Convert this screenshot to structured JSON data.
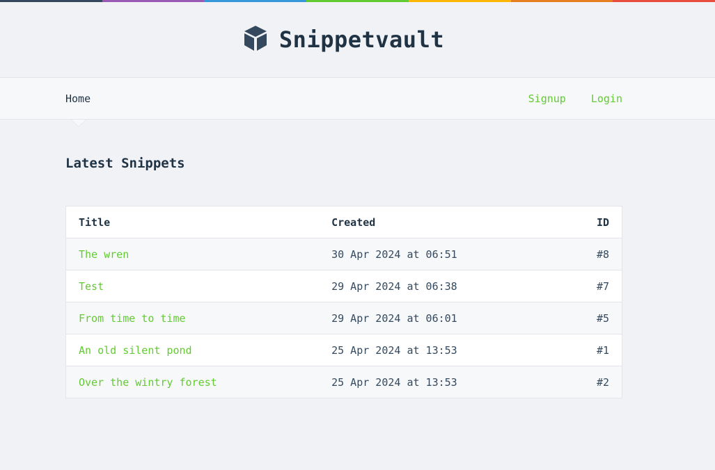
{
  "rainbow": [
    "#34495e",
    "#9b59b6",
    "#3498db",
    "#62cb31",
    "#ffb606",
    "#e67e22",
    "#e74c3c"
  ],
  "brand": {
    "name": "Snippetvault",
    "icon": "cube-icon"
  },
  "nav": {
    "home": "Home",
    "signup": "Signup",
    "login": "Login"
  },
  "page": {
    "heading": "Latest Snippets"
  },
  "table": {
    "headers": {
      "title": "Title",
      "created": "Created",
      "id": "ID"
    },
    "rows": [
      {
        "title": "The wren",
        "created": "30 Apr 2024 at 06:51",
        "id": "#8"
      },
      {
        "title": "Test",
        "created": "29 Apr 2024 at 06:38",
        "id": "#7"
      },
      {
        "title": "From time to time",
        "created": "29 Apr 2024 at 06:01",
        "id": "#5"
      },
      {
        "title": "An old silent pond",
        "created": "25 Apr 2024 at 13:53",
        "id": "#1"
      },
      {
        "title": "Over the wintry forest",
        "created": "25 Apr 2024 at 13:53",
        "id": "#2"
      }
    ]
  },
  "colors": {
    "link": "#62cb31",
    "heading": "#1f3344"
  }
}
